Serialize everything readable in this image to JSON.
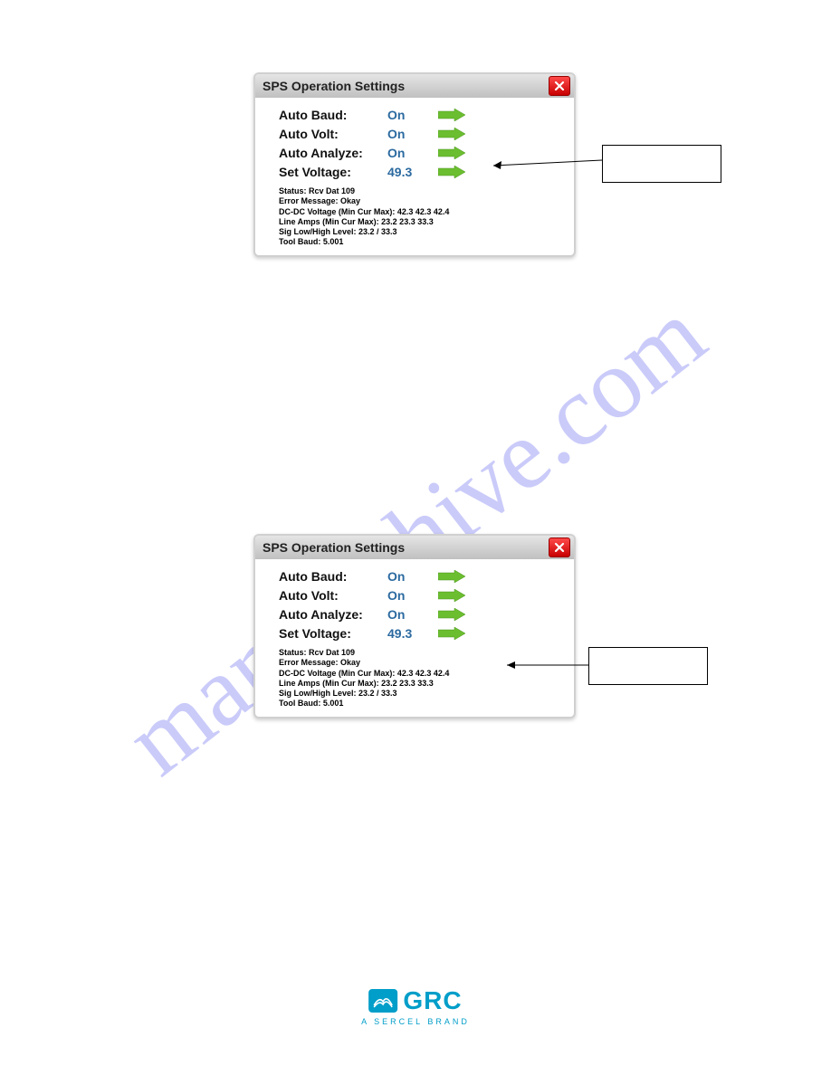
{
  "watermark": "manualshive.com",
  "dialogs": [
    {
      "title": "SPS Operation Settings",
      "rows": [
        {
          "label": "Auto Baud:",
          "value": "On"
        },
        {
          "label": "Auto Volt:",
          "value": "On"
        },
        {
          "label": "Auto Analyze:",
          "value": "On"
        },
        {
          "label": "Set Voltage:",
          "value": "49.3"
        }
      ],
      "status": {
        "status": "Status: Rcv Dat 109",
        "error": "Error Message: Okay",
        "dcdc": "DC-DC Voltage (Min Cur Max): 42.3  42.3  42.4",
        "line": "Line Amps (Min Cur Max): 23.2  23.3  33.3",
        "sig": "Sig Low/High Level: 23.2 / 33.3",
        "baud": "Tool Baud: 5.001"
      }
    },
    {
      "title": "SPS Operation Settings",
      "rows": [
        {
          "label": "Auto Baud:",
          "value": "On"
        },
        {
          "label": "Auto Volt:",
          "value": "On"
        },
        {
          "label": "Auto Analyze:",
          "value": "On"
        },
        {
          "label": "Set Voltage:",
          "value": "49.3"
        }
      ],
      "status": {
        "status": "Status: Rcv Dat 109",
        "error": "Error Message: Okay",
        "dcdc": "DC-DC Voltage (Min Cur Max): 42.3  42.3  42.4",
        "line": "Line Amps (Min Cur Max): 23.2  23.3  33.3",
        "sig": "Sig Low/High Level: 23.2 / 33.3",
        "baud": "Tool Baud: 5.001"
      }
    }
  ],
  "footer": {
    "brand": "GRC",
    "tagline": "A SERCEL BRAND"
  }
}
